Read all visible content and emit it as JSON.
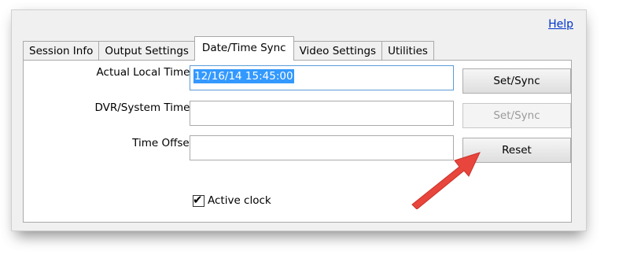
{
  "header": {
    "help_label": "Help"
  },
  "tabs": [
    {
      "label": "Session Info",
      "active": false
    },
    {
      "label": "Output Settings",
      "active": false
    },
    {
      "label": "Date/Time Sync",
      "active": true
    },
    {
      "label": "Video Settings",
      "active": false
    },
    {
      "label": "Utilities",
      "active": false
    }
  ],
  "form": {
    "actual_local_time": {
      "label": "Actual Local Time:",
      "value": "12/16/14 15:45:00",
      "button_label": "Set/Sync"
    },
    "dvr_system_time": {
      "label": "DVR/System Time:",
      "value": "",
      "button_label": "Set/Sync"
    },
    "time_offset": {
      "label": "Time Offset",
      "value": "",
      "button_label": "Reset"
    },
    "active_clock": {
      "label": "Active clock",
      "checked": true
    }
  },
  "colors": {
    "selection": "#3399ff",
    "annotation_arrow": "#e8453c",
    "link": "#0033cc"
  }
}
